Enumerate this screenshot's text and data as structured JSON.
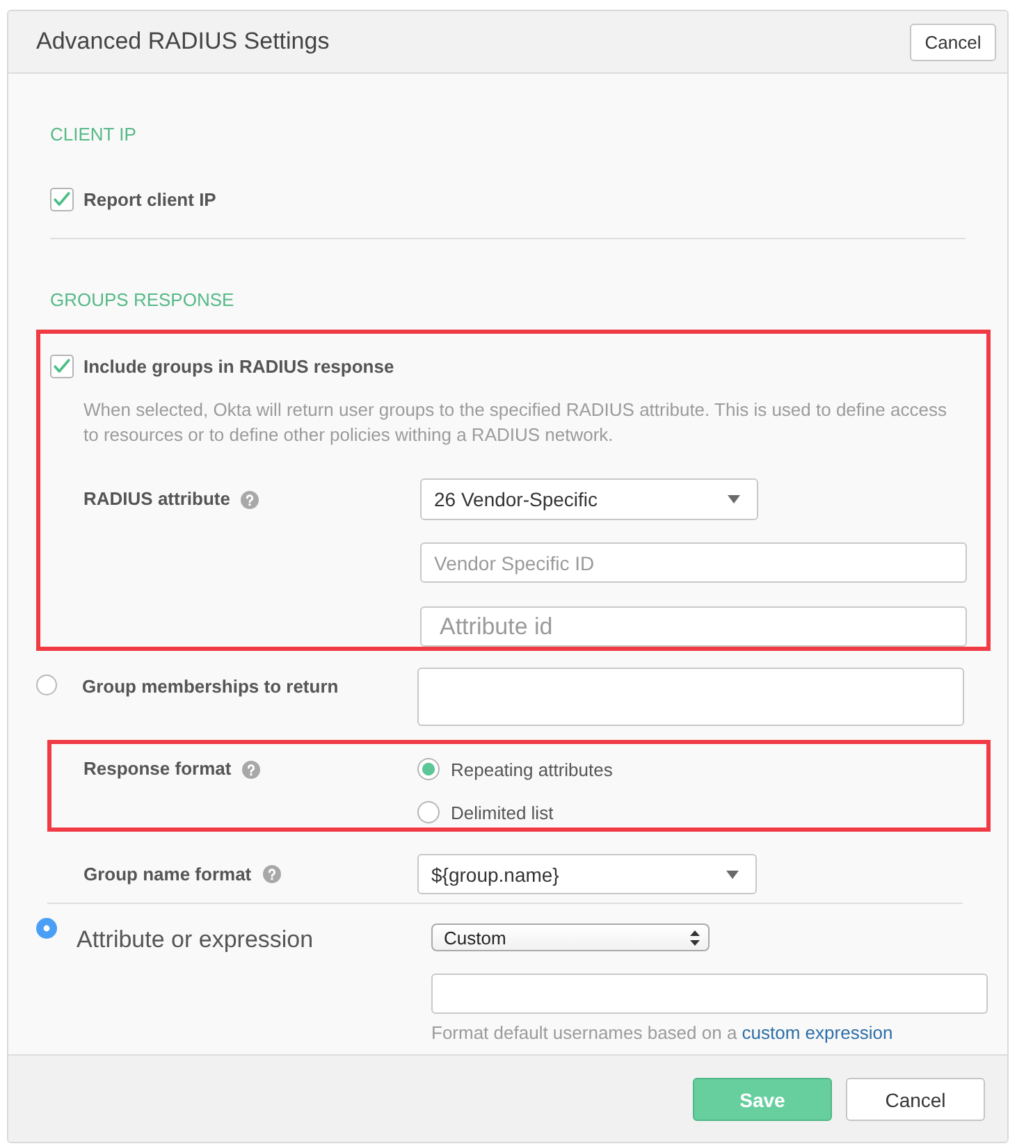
{
  "header": {
    "title": "Advanced RADIUS Settings",
    "cancel_button": "Cancel"
  },
  "client_ip": {
    "heading": "CLIENT IP",
    "report_client_ip": {
      "label": "Report client IP",
      "checked": true
    }
  },
  "groups_response": {
    "heading": "GROUPS RESPONSE",
    "highlighted": true,
    "include_groups": {
      "label": "Include groups in RADIUS response",
      "checked": true
    },
    "description": "When selected, Okta will return user groups to the specified RADIUS attribute. This is used to define access to resources or to define other policies withing a RADIUS network.",
    "radius_attribute": {
      "label": "RADIUS attribute",
      "value": "26 Vendor-Specific"
    },
    "vendor_specific_id": {
      "placeholder": "Vendor Specific ID"
    },
    "attribute_id": {
      "placeholder": "Attribute id"
    }
  },
  "group_memberships": {
    "label": "Group memberships to return",
    "selected": false
  },
  "response_format": {
    "label": "Response format",
    "highlighted": true,
    "options": [
      {
        "label": "Repeating attributes",
        "selected": true
      },
      {
        "label": "Delimited list",
        "selected": false
      }
    ]
  },
  "group_name_format": {
    "label": "Group name format",
    "value": "${group.name}"
  },
  "attribute_or_expression": {
    "label": "Attribute or expression",
    "selected": true,
    "select_value": "Custom",
    "hint": "Format default usernames based on a",
    "hint_link": "custom expression"
  },
  "footer": {
    "buttons": [
      {
        "label": "Save",
        "kind": "primary"
      },
      {
        "label": "Cancel",
        "kind": "secondary"
      }
    ]
  }
}
